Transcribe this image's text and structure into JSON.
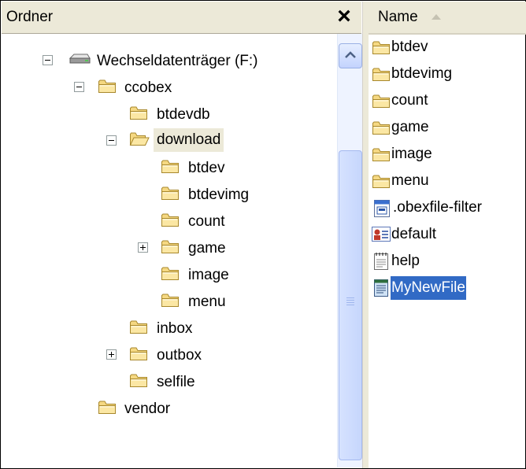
{
  "folder_pane": {
    "title": "Ordner",
    "close_symbol": "×"
  },
  "tree": {
    "drive": "Wechseldatenträger (F:)",
    "ccobex": "ccobex",
    "btdevdb": "btdevdb",
    "download": "download",
    "d_btdev": "btdev",
    "d_btdevimg": "btdevimg",
    "d_count": "count",
    "d_game": "game",
    "d_image": "image",
    "d_menu": "menu",
    "inbox": "inbox",
    "outbox": "outbox",
    "selfile": "selfile",
    "vendor": "vendor"
  },
  "file_list": {
    "column_name": "Name",
    "items": [
      {
        "label": "btdev",
        "icon": "folder-icon"
      },
      {
        "label": "btdevimg",
        "icon": "folder-icon"
      },
      {
        "label": "count",
        "icon": "folder-icon"
      },
      {
        "label": "game",
        "icon": "folder-icon"
      },
      {
        "label": "image",
        "icon": "folder-icon"
      },
      {
        "label": "menu",
        "icon": "folder-icon"
      },
      {
        "label": ".obexfile-filter",
        "icon": "window-file-icon"
      },
      {
        "label": "default",
        "icon": "contact-card-icon"
      },
      {
        "label": "help",
        "icon": "notepad-icon"
      },
      {
        "label": "MyNewFile",
        "icon": "text-file-icon"
      }
    ]
  },
  "colors": {
    "selection": "#316ac5",
    "tree_selection": "#ece9d8",
    "folder": "#f2ce5a"
  }
}
